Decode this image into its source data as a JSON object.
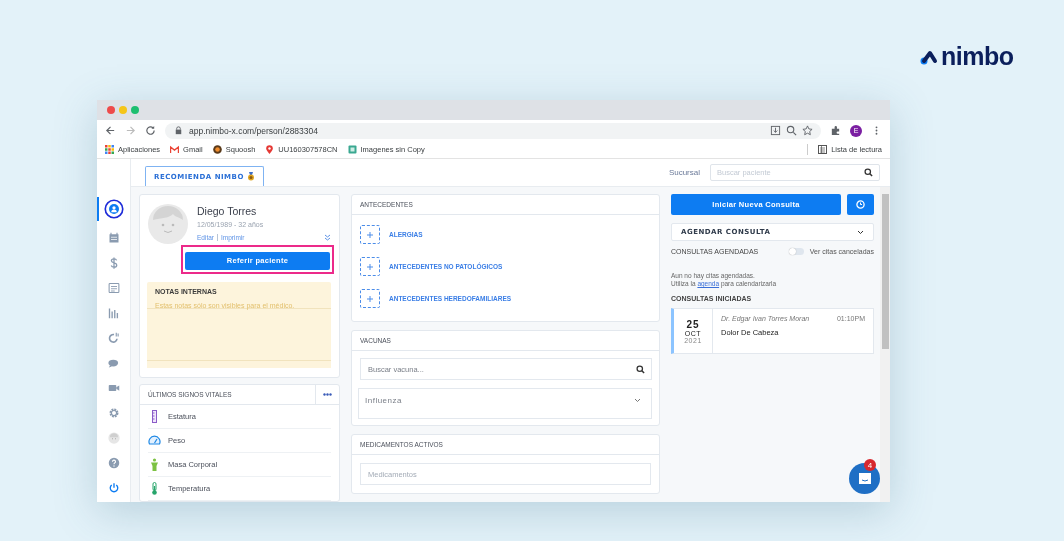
{
  "brand": {
    "name": "nimbo"
  },
  "browser": {
    "url": "app.nimbo-x.com/person/2883304",
    "profile_initial": "E",
    "bookmarks": [
      {
        "kind": "apps",
        "label": "Aplicaciones"
      },
      {
        "kind": "mail",
        "label": "Gmail"
      },
      {
        "kind": "circle",
        "label": "Squoosh"
      },
      {
        "kind": "pin",
        "label": "UU160307578CN"
      },
      {
        "kind": "doc",
        "label": "Imagenes sin Copy"
      }
    ],
    "reading_list": "Lista de lectura"
  },
  "sidebar": {
    "items": [
      {
        "kind": "person",
        "selected": true
      },
      {
        "kind": "calendar",
        "selected": false
      },
      {
        "kind": "dollar",
        "selected": false
      },
      {
        "kind": "list",
        "selected": false
      },
      {
        "kind": "bars",
        "selected": false
      },
      {
        "kind": "rotate",
        "selected": false
      },
      {
        "kind": "chat",
        "selected": false
      },
      {
        "kind": "video",
        "selected": false
      },
      {
        "kind": "gear",
        "selected": false
      },
      {
        "kind": "avatar",
        "selected": false
      },
      {
        "kind": "help",
        "selected": false
      },
      {
        "kind": "power",
        "selected": false
      }
    ]
  },
  "topbar": {
    "promo_button": "RECOMIENDA NIMBO",
    "branch_label": "Sucursal",
    "search": {
      "placeholder": "Buscar paciente"
    }
  },
  "patient": {
    "name": "Diego Torres",
    "birth": "12/05/1989 - 32 años",
    "links": [
      "Editar",
      "Imprimir"
    ],
    "refer_button": "Referir paciente",
    "highlighted": true,
    "notes": {
      "title": "NOTAS INTERNAS",
      "placeholder": "Estas notas sólo son visibles para el médico."
    }
  },
  "vitals": {
    "title": "ÚLTIMOS SIGNOS VITALES",
    "items": [
      {
        "kind": "ruler",
        "label": "Estatura"
      },
      {
        "kind": "gauge",
        "label": "Peso"
      },
      {
        "kind": "body",
        "label": "Masa Corporal"
      },
      {
        "kind": "thermometer",
        "label": "Temperatura"
      }
    ]
  },
  "antecedentes": {
    "title": "ANTECEDENTES",
    "items": [
      "ALERGIAS",
      "ANTECEDENTES NO PATOLÓGICOS",
      "ANTECEDENTES HEREDOFAMILIARES"
    ]
  },
  "vacunas": {
    "title": "VACUNAS",
    "search": {
      "placeholder": "Buscar vacuna..."
    },
    "selected_vaccine": "Influenza"
  },
  "medicamentos": {
    "title": "MEDICAMENTOS ACTIVOS",
    "field": {
      "placeholder": "Medicamentos"
    }
  },
  "consultas": {
    "new_button": "Iniciar Nueva Consulta",
    "schedule_dropdown": "AGENDAR CONSULTA",
    "scheduled": {
      "title": "CONSULTAS AGENDADAS",
      "toggle": {
        "label": "Ver citas canceladas",
        "on": false
      },
      "empty_text": "Aun no hay citas agendadas.",
      "hint_before": "Utiliza la",
      "hint_link": "agenda",
      "hint_after": "para calendarizarla"
    },
    "started": {
      "title": "CONSULTAS INICIADAS",
      "items": [
        {
          "day": "25",
          "month": "OCT",
          "year": "2021",
          "doctor": "Dr. Edgar Ivan Torres Moran",
          "time": "01:10PM",
          "reason": "Dolor De Cabeza"
        }
      ]
    }
  },
  "chat": {
    "badge": "4"
  }
}
